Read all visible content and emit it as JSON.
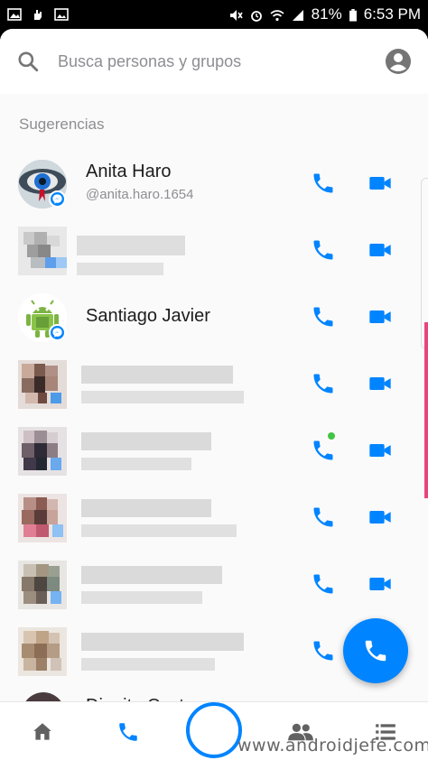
{
  "status_bar": {
    "battery": "81%",
    "time": "6:53 PM",
    "icons": [
      "gallery-icon",
      "hand-icon",
      "image-icon",
      "mute-icon",
      "alarm-icon",
      "wifi-icon",
      "signal-icon",
      "battery-icon"
    ]
  },
  "search": {
    "placeholder": "Busca personas y grupos"
  },
  "section": {
    "title": "Sugerencias"
  },
  "contacts": [
    {
      "name": "Anita Haro",
      "handle": "@anita.haro.1654",
      "blurred": false,
      "online": false
    },
    {
      "name": "",
      "handle": "",
      "blurred": true,
      "online": false
    },
    {
      "name": "Santiago Javier",
      "handle": "",
      "blurred": false,
      "online": false
    },
    {
      "name": "",
      "handle": "",
      "blurred": true,
      "online": false
    },
    {
      "name": "",
      "handle": "",
      "blurred": true,
      "online": true
    },
    {
      "name": "",
      "handle": "",
      "blurred": true,
      "online": false
    },
    {
      "name": "",
      "handle": "",
      "blurred": true,
      "online": false
    },
    {
      "name": "",
      "handle": "",
      "blurred": true,
      "online": false
    }
  ],
  "peek_contact": {
    "name": "Dianita Costa"
  },
  "bottom_nav": [
    "home-icon",
    "phone-icon",
    "camera-shutter",
    "people-icon",
    "list-icon"
  ],
  "colors": {
    "accent": "#0084ff",
    "online": "#43c443",
    "text": "#1c1c1c",
    "subtle": "#8e8e93"
  },
  "watermark": "www.androidjefe.com"
}
